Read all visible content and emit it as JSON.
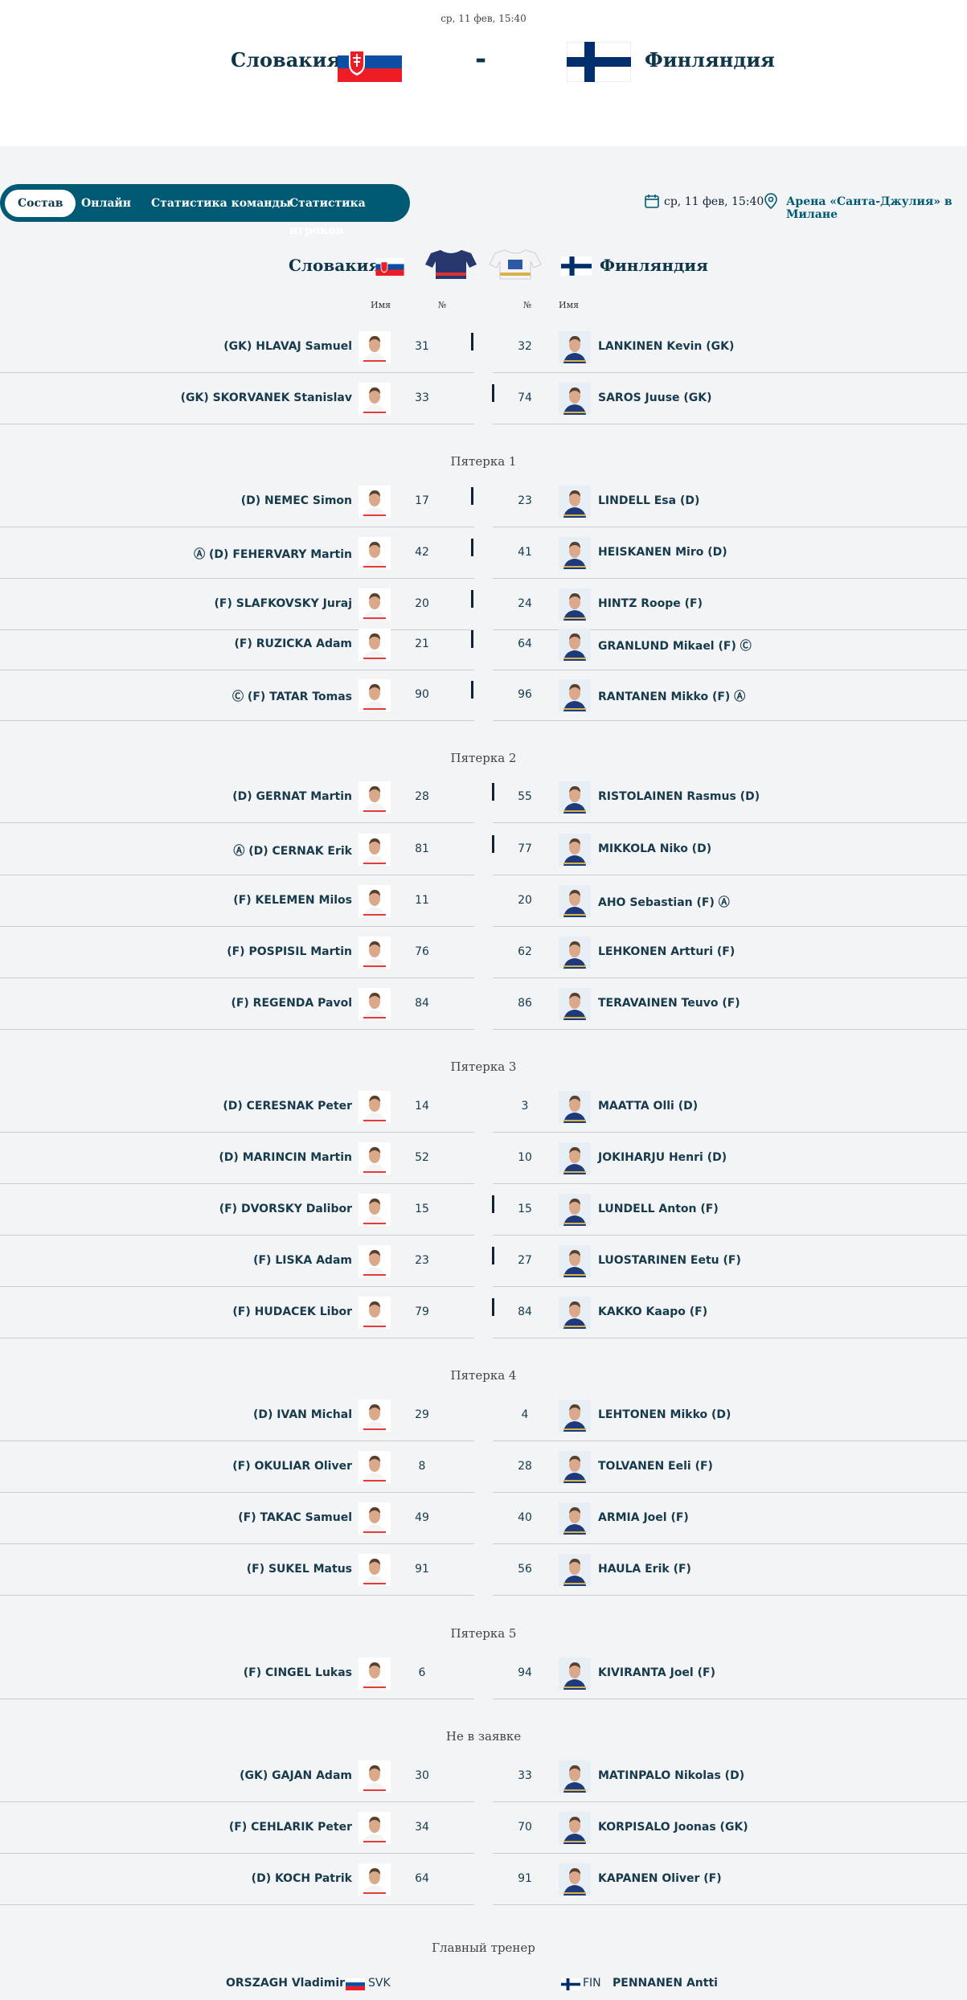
{
  "header": {
    "date": "ср, 11 фев, 15:40",
    "home_team": "Словакия",
    "away_team": "Финляндия",
    "separator": "-"
  },
  "tabs": [
    {
      "label": "Состав",
      "active": true
    },
    {
      "label": "Онлайн",
      "active": false
    },
    {
      "label": "Статистика команды",
      "active": false
    },
    {
      "label": "Статистика игроков",
      "active": false
    }
  ],
  "meta": {
    "date": "ср, 11 фев, 15:40",
    "venue": "Арена «Санта-Джулия» в Милане"
  },
  "columns": {
    "name": "Имя",
    "number": "№"
  },
  "sections": [
    {
      "title": "",
      "rows": [
        {
          "home": {
            "name": "(GK) HLAVAJ Samuel",
            "num": "31"
          },
          "away": {
            "name": "LANKINEN Kevin (GK)",
            "num": "32"
          }
        },
        {
          "home": {
            "name": "(GK) SKORVANEK Stanislav",
            "num": "33"
          },
          "away": {
            "name": "SAROS Juuse (GK)",
            "num": "74"
          }
        }
      ]
    },
    {
      "title": "Пятерка 1",
      "rows": [
        {
          "home": {
            "name": "(D) NEMEC Simon",
            "num": "17"
          },
          "away": {
            "name": "LINDELL Esa (D)",
            "num": "23"
          }
        },
        {
          "home": {
            "name": "Ⓐ (D) FEHERVARY Martin",
            "num": "42"
          },
          "away": {
            "name": "HEISKANEN Miro (D)",
            "num": "41"
          }
        },
        {
          "home": {
            "name": "(F) SLAFKOVSKY Juraj",
            "num": "20"
          },
          "away": {
            "name": "HINTZ Roope (F)",
            "num": "24"
          }
        },
        {
          "home": {
            "name": "(F) RUZICKA Adam",
            "num": "21"
          },
          "away": {
            "name": "GRANLUND Mikael (F) Ⓒ",
            "num": "64"
          }
        },
        {
          "home": {
            "name": "Ⓒ (F) TATAR Tomas",
            "num": "90"
          },
          "away": {
            "name": "RANTANEN Mikko (F) Ⓐ",
            "num": "96"
          }
        }
      ]
    },
    {
      "title": "Пятерка 2",
      "rows": [
        {
          "home": {
            "name": "(D) GERNAT Martin",
            "num": "28"
          },
          "away": {
            "name": "RISTOLAINEN Rasmus (D)",
            "num": "55"
          }
        },
        {
          "home": {
            "name": "Ⓐ (D) CERNAK Erik",
            "num": "81"
          },
          "away": {
            "name": "MIKKOLA Niko (D)",
            "num": "77"
          }
        },
        {
          "home": {
            "name": "(F) KELEMEN Milos",
            "num": "11"
          },
          "away": {
            "name": "AHO Sebastian (F) Ⓐ",
            "num": "20"
          }
        },
        {
          "home": {
            "name": "(F) POSPISIL Martin",
            "num": "76"
          },
          "away": {
            "name": "LEHKONEN Artturi (F)",
            "num": "62"
          }
        },
        {
          "home": {
            "name": "(F) REGENDA Pavol",
            "num": "84"
          },
          "away": {
            "name": "TERAVAINEN Teuvo (F)",
            "num": "86"
          }
        }
      ]
    },
    {
      "title": "Пятерка 3",
      "rows": [
        {
          "home": {
            "name": "(D) CERESNAK Peter",
            "num": "14"
          },
          "away": {
            "name": "MAATTA Olli (D)",
            "num": "3"
          }
        },
        {
          "home": {
            "name": "(D) MARINCIN Martin",
            "num": "52"
          },
          "away": {
            "name": "JOKIHARJU Henri (D)",
            "num": "10"
          }
        },
        {
          "home": {
            "name": "(F) DVORSKY Dalibor",
            "num": "15"
          },
          "away": {
            "name": "LUNDELL Anton (F)",
            "num": "15"
          }
        },
        {
          "home": {
            "name": "(F) LISKA Adam",
            "num": "23"
          },
          "away": {
            "name": "LUOSTARINEN Eetu (F)",
            "num": "27"
          }
        },
        {
          "home": {
            "name": "(F) HUDACEK Libor",
            "num": "79"
          },
          "away": {
            "name": "KAKKO Kaapo (F)",
            "num": "84"
          }
        }
      ]
    },
    {
      "title": "Пятерка 4",
      "rows": [
        {
          "home": {
            "name": "(D) IVAN Michal",
            "num": "29"
          },
          "away": {
            "name": "LEHTONEN Mikko (D)",
            "num": "4"
          }
        },
        {
          "home": {
            "name": "(F) OKULIAR Oliver",
            "num": "8"
          },
          "away": {
            "name": "TOLVANEN Eeli (F)",
            "num": "28"
          }
        },
        {
          "home": {
            "name": "(F) TAKAC Samuel",
            "num": "49"
          },
          "away": {
            "name": "ARMIA Joel (F)",
            "num": "40"
          }
        },
        {
          "home": {
            "name": "(F) SUKEL Matus",
            "num": "91"
          },
          "away": {
            "name": "HAULA Erik (F)",
            "num": "56"
          }
        }
      ]
    },
    {
      "title": "Пятерка 5",
      "rows": [
        {
          "home": {
            "name": "(F) CINGEL Lukas",
            "num": "6"
          },
          "away": {
            "name": "KIVIRANTA Joel (F)",
            "num": "94"
          }
        }
      ]
    },
    {
      "title": "Не в заявке",
      "rows": [
        {
          "home": {
            "name": "(GK) GAJAN Adam",
            "num": "30"
          },
          "away": {
            "name": "MATINPALO Nikolas (D)",
            "num": "33"
          }
        },
        {
          "home": {
            "name": "(F) CEHLARIK Peter",
            "num": "34"
          },
          "away": {
            "name": "KORPISALO Joonas (GK)",
            "num": "70"
          }
        },
        {
          "home": {
            "name": "(D) KOCH Patrik",
            "num": "64"
          },
          "away": {
            "name": "KAPANEN Oliver (F)",
            "num": "91"
          }
        }
      ]
    }
  ],
  "coach": {
    "title": "Главный тренер",
    "home_name": "ORSZAGH Vladimir",
    "home_code": "SVK",
    "away_code": "FIN",
    "away_name": "PENNANEN Antti"
  },
  "colors": {
    "accent": "#005a73",
    "text": "#0d3b4f",
    "divider": "#c9cdd0"
  }
}
